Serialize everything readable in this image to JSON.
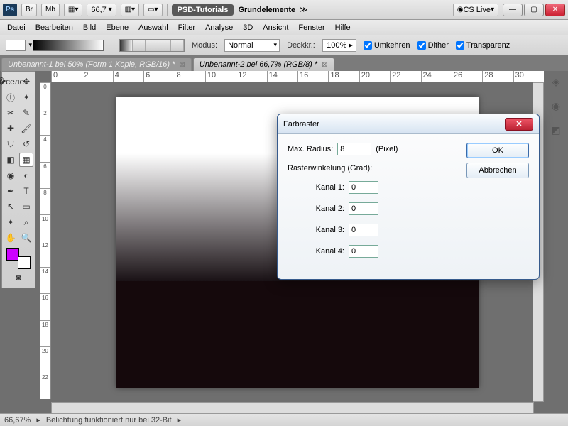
{
  "titlebar": {
    "ps": "Ps",
    "br": "Br",
    "mb": "Mb",
    "zoom": "66,7",
    "title_main": "PSD-Tutorials",
    "title_sub": "Grundelemente",
    "cslive": "CS Live"
  },
  "menu": [
    "Datei",
    "Bearbeiten",
    "Bild",
    "Ebene",
    "Auswahl",
    "Filter",
    "Analyse",
    "3D",
    "Ansicht",
    "Fenster",
    "Hilfe"
  ],
  "options": {
    "modus_label": "Modus:",
    "modus_value": "Normal",
    "deckkr_label": "Deckkr.:",
    "deckkr_value": "100%",
    "umkehren": "Umkehren",
    "dither": "Dither",
    "transparenz": "Transparenz"
  },
  "tabs": [
    "Unbenannt-1 bei 50% (Form 1 Kopie, RGB/16) *",
    "Unbenannt-2 bei 66,7% (RGB/8) *"
  ],
  "ruler_h": [
    "0",
    "2",
    "4",
    "6",
    "8",
    "10",
    "12",
    "14",
    "16",
    "18",
    "20",
    "22",
    "24",
    "26",
    "28",
    "30"
  ],
  "ruler_v": [
    "0",
    "2",
    "4",
    "6",
    "8",
    "10",
    "12",
    "14",
    "16",
    "18",
    "20",
    "22"
  ],
  "status": {
    "zoom": "66,67%",
    "msg": "Belichtung funktioniert nur bei 32-Bit"
  },
  "dialog": {
    "title": "Farbraster",
    "max_radius_label": "Max. Radius:",
    "max_radius_value": "8",
    "pixel": "(Pixel)",
    "raster_label": "Rasterwinkelung (Grad):",
    "k1": "Kanal 1:",
    "v1": "0",
    "k2": "Kanal 2:",
    "v2": "0",
    "k3": "Kanal 3:",
    "v3": "0",
    "k4": "Kanal 4:",
    "v4": "0",
    "ok": "OK",
    "cancel": "Abbrechen"
  }
}
